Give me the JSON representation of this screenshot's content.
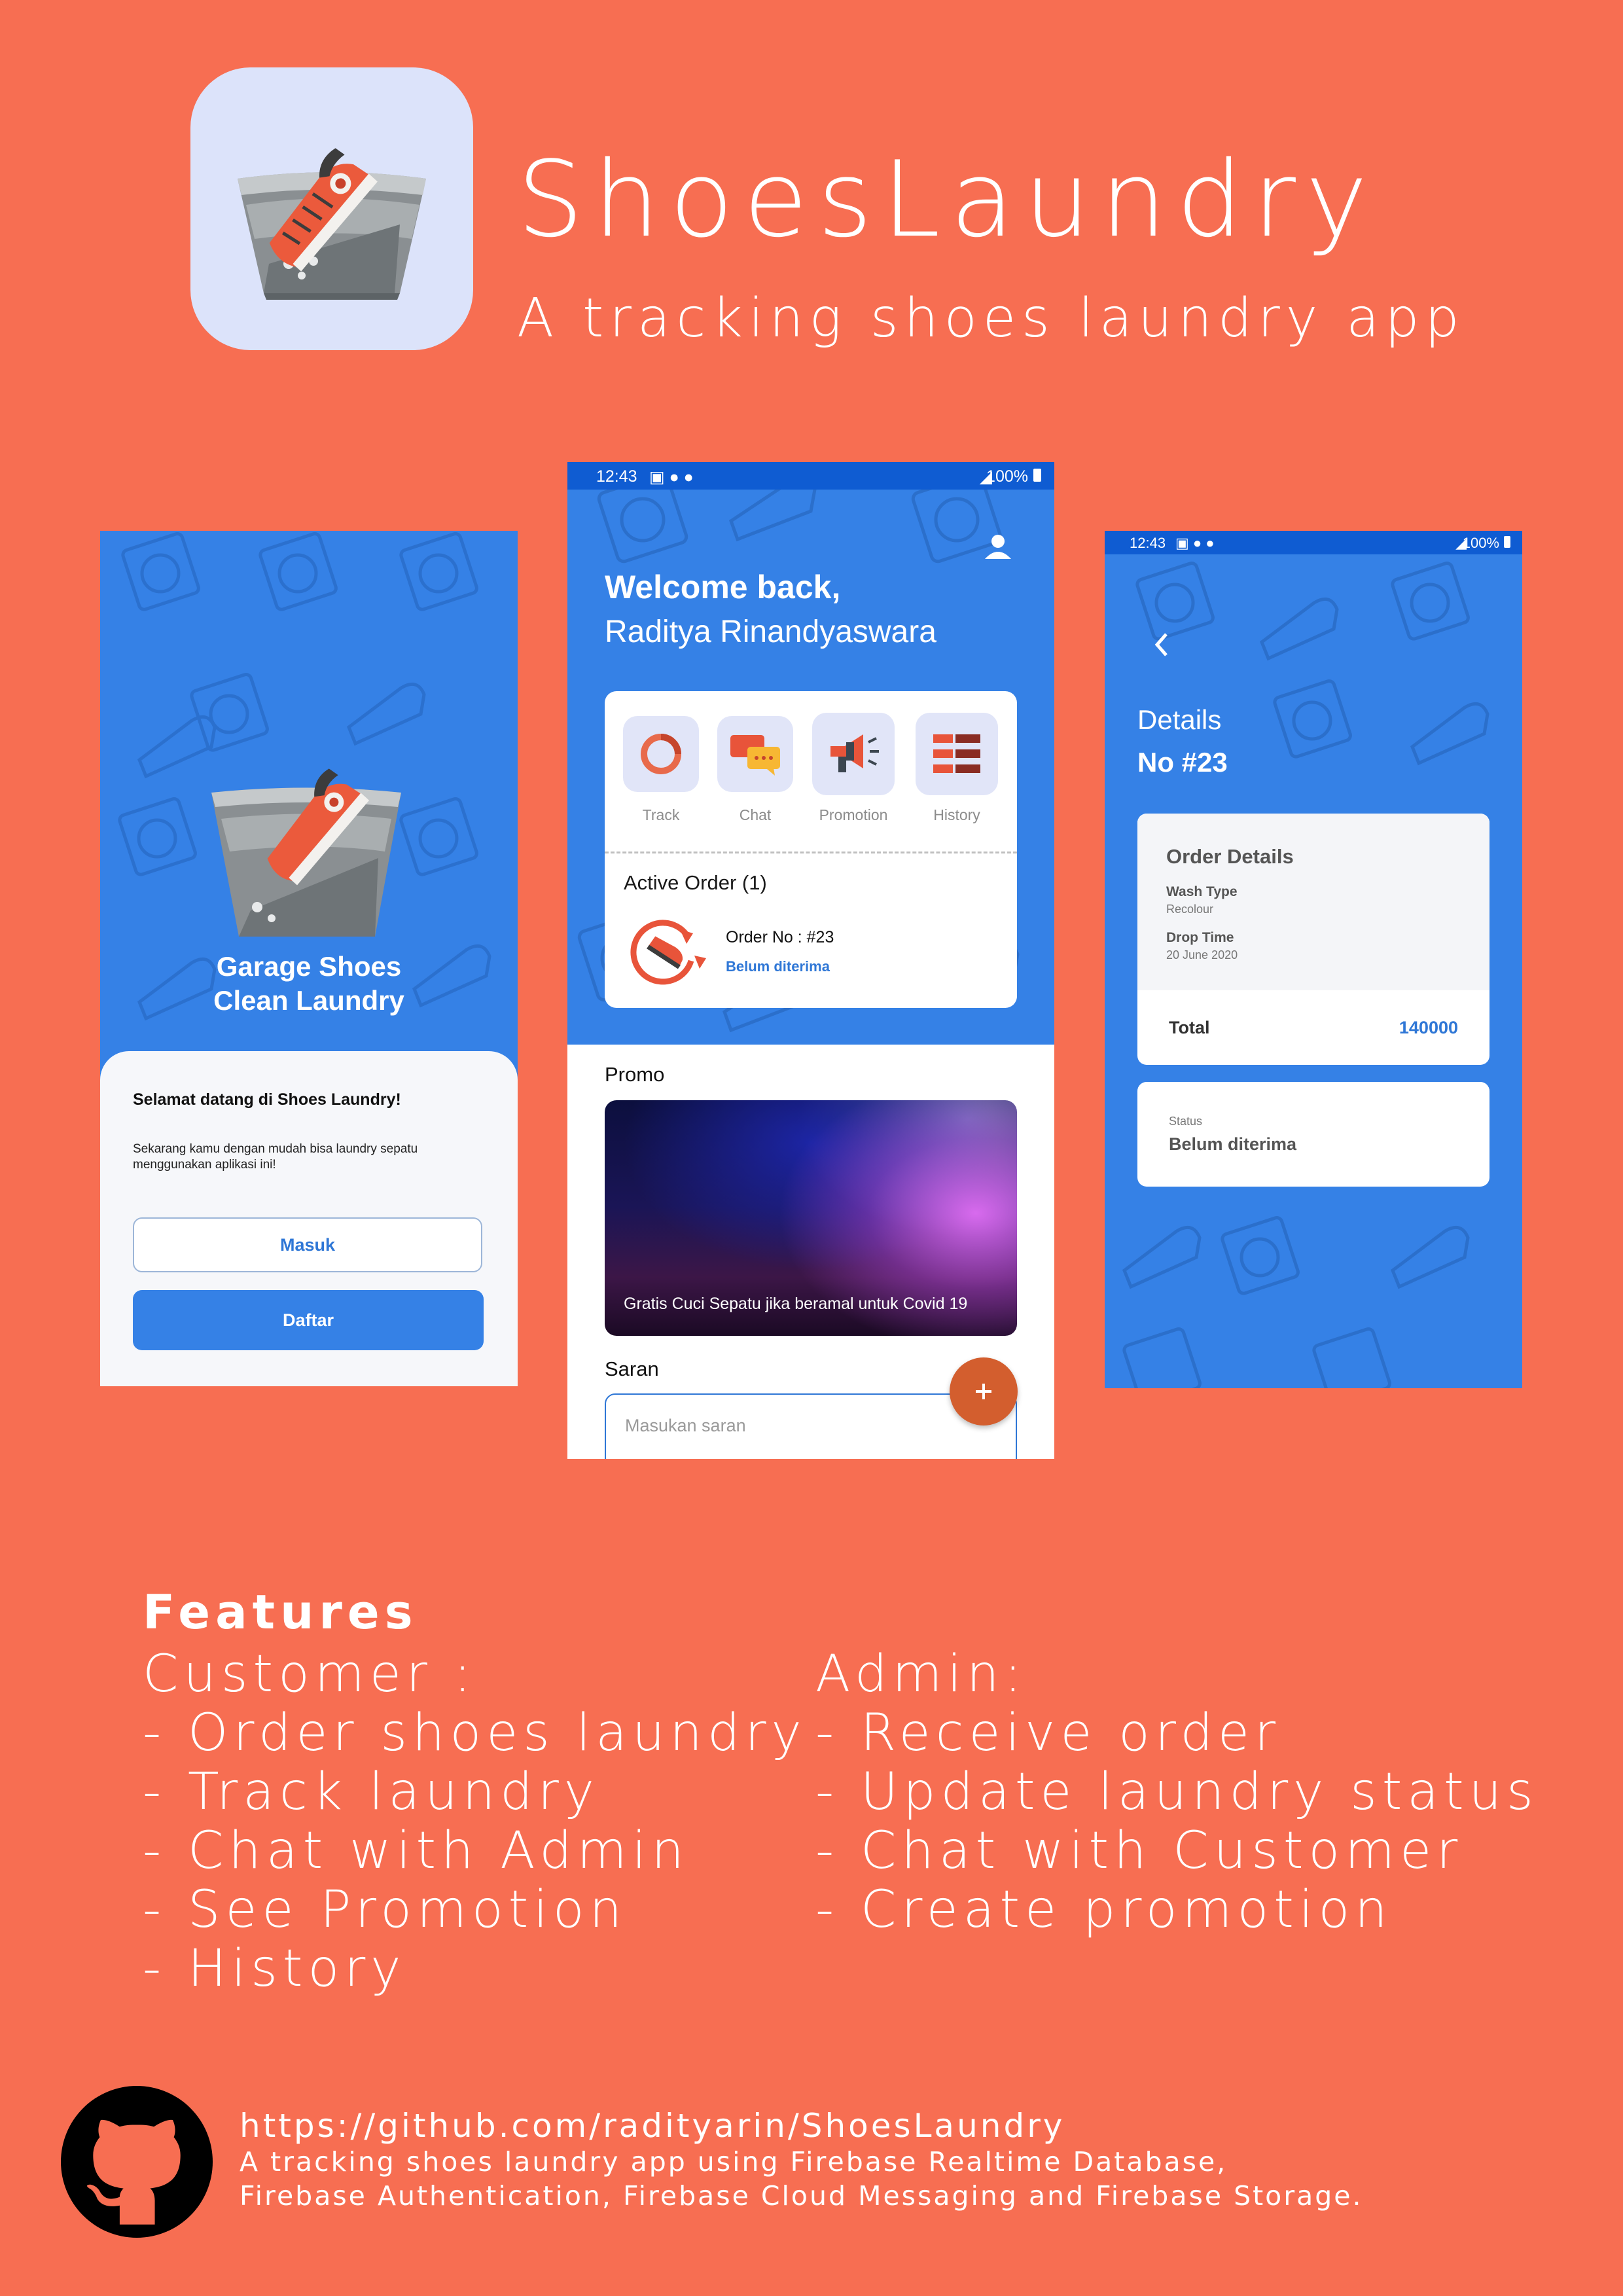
{
  "header": {
    "app_name": "ShoesLaundry",
    "tagline": "A tracking shoes laundry app"
  },
  "screen_login": {
    "brand_line1": "Garage Shoes",
    "brand_line2": "Clean Laundry",
    "welcome_title": "Selamat datang di Shoes Laundry!",
    "welcome_desc": "Sekarang kamu dengan mudah bisa laundry sepatu menggunakan aplikasi ini!",
    "login_label": "Masuk",
    "register_label": "Daftar"
  },
  "screen_home": {
    "status_time": "12:43",
    "status_battery": "100%",
    "greeting": "Welcome back,",
    "user_name": "Raditya Rinandyaswara",
    "menu": [
      {
        "label": "Track",
        "icon": "track-ring-icon"
      },
      {
        "label": "Chat",
        "icon": "chat-bubbles-icon"
      },
      {
        "label": "Promotion",
        "icon": "megaphone-icon"
      },
      {
        "label": "History",
        "icon": "list-icon"
      }
    ],
    "active_order_title": "Active Order (1)",
    "active_order": {
      "number": "Order No : #23",
      "status": "Belum diterima"
    },
    "promo_title": "Promo",
    "promo_banner_text": "Gratis Cuci Sepatu jika beramal untuk Covid 19",
    "saran_title": "Saran",
    "saran_placeholder": "Masukan saran"
  },
  "screen_details": {
    "status_time": "12:43",
    "status_battery": "100%",
    "title": "Details",
    "order_no": "No #23",
    "card_title": "Order Details",
    "wash_type_label": "Wash Type",
    "wash_type_value": "Recolour",
    "drop_time_label": "Drop Time",
    "drop_time_value": "20 June 2020",
    "total_label": "Total",
    "total_value": "140000",
    "status_label": "Status",
    "status_value": "Belum diterima"
  },
  "features": {
    "title": "Features",
    "customer_title": "Customer :",
    "customer_items": [
      "- Order shoes laundry",
      "- Track laundry",
      "- Chat with Admin",
      "- See Promotion",
      "- History"
    ],
    "admin_title": "Admin:",
    "admin_items": [
      "- Receive order",
      "- Update laundry status",
      "- Chat with Customer",
      "- Create promotion"
    ]
  },
  "footer": {
    "repo_url": "https://github.com/radityarin/ShoesLaundry",
    "desc_line1": "A tracking shoes laundry app using Firebase Realtime Database,",
    "desc_line2": "Firebase Authentication, Firebase Cloud Messaging and Firebase Storage."
  },
  "colors": {
    "background": "#F76E52",
    "primary_blue": "#3581E6",
    "status_bar": "#0F5CD2",
    "accent_orange": "#D35E2E"
  }
}
